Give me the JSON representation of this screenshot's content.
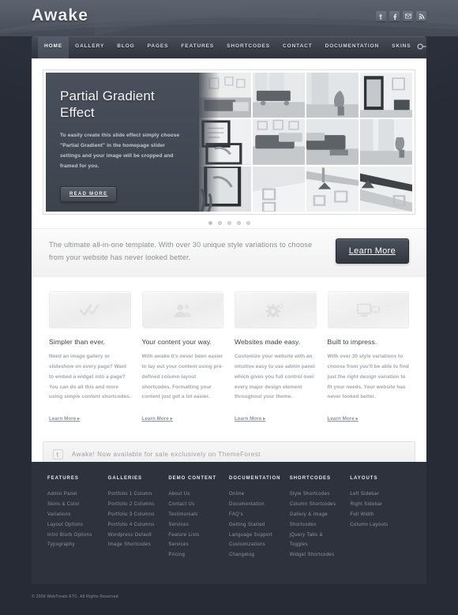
{
  "header": {
    "logo": "Awake",
    "social": [
      {
        "name": "twitter-icon",
        "glyph": "t"
      },
      {
        "name": "facebook-icon",
        "glyph": "f"
      },
      {
        "name": "email-icon",
        "glyph": "✉"
      },
      {
        "name": "rss-icon",
        "glyph": "⚡"
      }
    ]
  },
  "nav": {
    "items": [
      {
        "label": "HOME",
        "active": true
      },
      {
        "label": "GALLERY",
        "active": false
      },
      {
        "label": "BLOG",
        "active": false
      },
      {
        "label": "PAGES",
        "active": false
      },
      {
        "label": "FEATURES",
        "active": false
      },
      {
        "label": "SHORTCODES",
        "active": false
      },
      {
        "label": "CONTACT",
        "active": false
      },
      {
        "label": "DOCUMENTATION",
        "active": false
      },
      {
        "label": "SKINS",
        "active": false
      }
    ],
    "search_icon": "search-icon"
  },
  "slider": {
    "title": "Partial Gradient Effect",
    "body": "To easily create this slide effect simply choose \"Partial Gradient\" in the homepage slider settings and your image will be cropped and framed for you.",
    "button": "READ MORE",
    "dots_total": 5,
    "dots_active_index": 0
  },
  "tagline": {
    "text": "The ultimate all-in-one template. With over 30 unique style variations to choose from your website has never looked better.",
    "button": "Learn More"
  },
  "features": [
    {
      "icon": "double-check-icon",
      "title": "Simpler than ever.",
      "body": "Need an image gallery or slideshow on every page? Want to embed a widget into a page? You can do all this and more using simple content shortcodes.",
      "link": "Learn More ▸"
    },
    {
      "icon": "people-icon",
      "title": "Your content your way.",
      "body": "With awake it's never been easier to lay out your content using pre-defined column layout shortcodes. Formatting your content just got a lot easier.",
      "link": "Learn More ▸"
    },
    {
      "icon": "gears-icon",
      "title": "Websites made easy.",
      "body": "Customize your website with an intuitive easy to use admin panel which gives you full control over every major design element throughout your theme.",
      "link": "Learn More ▸"
    },
    {
      "icon": "monitors-icon",
      "title": "Built to impress.",
      "body": "With over 30 style variations to choose from you'll be able to find just the right design variation to fit your needs. Your website has never looked better.",
      "link": "Learn More ▸"
    }
  ],
  "notice": {
    "icon": "twitter-icon",
    "text": "Awake! Now available for sale exclusively on ThemeForest"
  },
  "footer": {
    "columns": [
      {
        "heading": "FEATURES",
        "links": [
          "Admin Panel",
          "Skins & Color",
          "Variations",
          "Layout Options",
          "Intro Blurb Options",
          "Typography"
        ]
      },
      {
        "heading": "GALLERIES",
        "links": [
          "Portfolio 1 Column",
          "Portfolio 2 Columns",
          "Portfolio 3 Columns",
          "Portfolio 4 Columns",
          "Wordpress Default",
          "Image Shortcodes"
        ]
      },
      {
        "heading": "DEMO CONTENT",
        "links": [
          "About Us",
          "Contact Us",
          "Testimonials",
          "Services",
          "Feature Lists",
          "Services",
          "Pricing"
        ]
      },
      {
        "heading": "DOCUMENTATION",
        "links": [
          "Online",
          "Documentation",
          "FAQ's",
          "Getting Started",
          "Language Support",
          "Customizations",
          "Changelog"
        ]
      },
      {
        "heading": "SHORTCODES",
        "links": [
          "Style Shortcodes",
          "Column Shortcodes",
          "Gallery & Image",
          "Shortcodes",
          "jQuery Tabs &",
          "Toggles",
          "Widget Shortcodes"
        ]
      },
      {
        "heading": "LAYOUTS",
        "links": [
          "Left Sidebar",
          "Right Sidebar",
          "Full Width",
          "Column Layouts"
        ]
      }
    ]
  },
  "copyright": "© 2009 WebTreats ETC. All Rights Reserved",
  "colors": {
    "page_bg": "#262b36",
    "header_bg": "#4e545f",
    "nav_bg": "#3a3f49",
    "panel_bg": "#ffffff",
    "footer_bg": "#2d323d",
    "slide_panel": "#3d434d"
  }
}
